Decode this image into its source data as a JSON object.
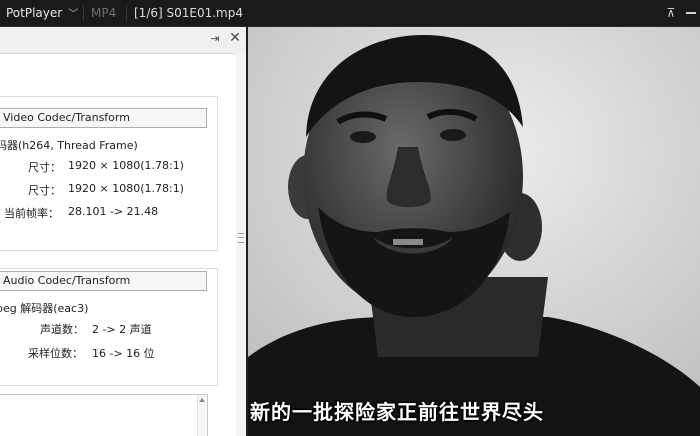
{
  "titlebar": {
    "app_name": "PotPlayer",
    "format": "MP4",
    "file_title": "[1/6] S01E01.mp4",
    "pin_glyph": "⊼"
  },
  "panel": {
    "pin_glyph": "⇥",
    "close_glyph": "✕",
    "video_section": {
      "button_label": "Video Codec/Transform",
      "decoder": "码器(h264, Thread Frame)",
      "size_in_label": "尺寸：",
      "size_in_value": "1920 × 1080(1.78:1)",
      "size_out_label": "尺寸：",
      "size_out_value": "1920 × 1080(1.78:1)",
      "fps_label": "当前帧率：",
      "fps_value": "28.101 -> 21.48"
    },
    "audio_section": {
      "button_label": "Audio Codec/Transform",
      "decoder": "peg 解码器(eac3)",
      "channels_label": "声道数：",
      "channels_value": "2 -> 2 声道",
      "bits_label": "采样位数：",
      "bits_value": "16 -> 16 位"
    }
  },
  "video": {
    "subtitle": "新的一批探险家正前往世界尽头"
  },
  "colors": {
    "titlebar_bg": "#1a1a1a",
    "panel_bg": "#f0f0f0",
    "video_bg": "#d8d8d8"
  }
}
